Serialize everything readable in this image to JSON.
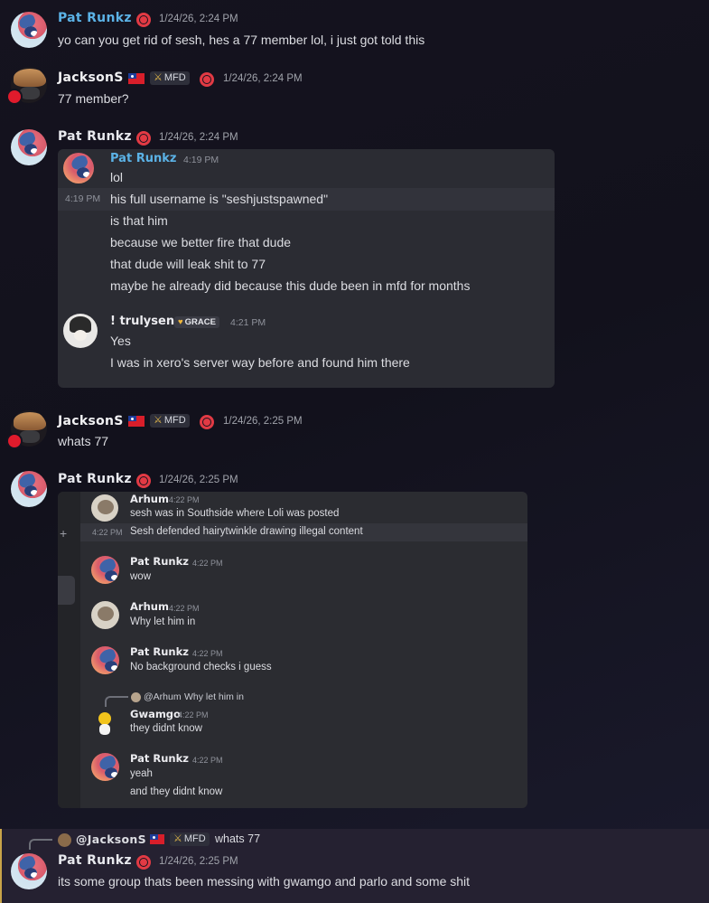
{
  "users": {
    "pat": "Pat Runkz",
    "jackson": "JacksonS",
    "senz": "! trulysenz",
    "arhum": "Arhum",
    "gwamgo": "Gwamgo"
  },
  "badges": {
    "mfd": "MFD",
    "grace": "GRACE"
  },
  "messages": [
    {
      "author": "Pat Runkz",
      "time": "1/24/26, 2:24 PM",
      "text": "yo can you get rid of sesh, hes a 77 member lol, i just got told this"
    },
    {
      "author": "JacksonS",
      "time": "1/24/26, 2:24 PM",
      "text": "77 member?"
    },
    {
      "author": "Pat Runkz",
      "time": "1/24/26, 2:24 PM"
    },
    {
      "author": "JacksonS",
      "time": "1/24/26, 2:25 PM",
      "text": "whats 77"
    },
    {
      "author": "Pat Runkz",
      "time": "1/24/26, 2:25 PM"
    },
    {
      "author": "Pat Runkz",
      "time": "1/24/26, 2:25 PM",
      "text": "its some group thats been messing with gwamgo and parlo and some shit"
    }
  ],
  "embed1": {
    "first_author": "Pat Runkz",
    "first_time": "4:19 PM",
    "hover_time": "4:19 PM",
    "lines": [
      "lol",
      "his full username is \"seshjustspawned\"",
      "is that him",
      "because we better fire that dude",
      "that dude will leak shit to 77",
      "maybe he already did because this dude been in mfd for months"
    ],
    "second_author": "! trulysenz",
    "second_badge": "GRACE",
    "second_time": "4:21 PM",
    "second_lines": [
      "Yes",
      "I was in xero's server way before and found him there"
    ]
  },
  "embed2": {
    "hover_time": "4:22 PM",
    "plus": "+",
    "items": [
      {
        "author": "Arhum",
        "time": "4:22 PM",
        "lines": [
          "sesh was in Southside where Loli was posted",
          "Sesh defended hairytwinkle drawing illegal content"
        ]
      },
      {
        "author": "Pat Runkz",
        "time": "4:22 PM",
        "lines": [
          "wow"
        ]
      },
      {
        "author": "Arhum",
        "time": "4:22 PM",
        "lines": [
          "Why let him in"
        ]
      },
      {
        "author": "Pat Runkz",
        "time": "4:22 PM",
        "lines": [
          "No background checks i guess"
        ]
      },
      {
        "author": "Gwamgo",
        "time": "4:22 PM",
        "reply_to": "@Arhum",
        "reply_text": "Why let him in",
        "lines": [
          "they didnt know"
        ]
      },
      {
        "author": "Pat Runkz",
        "time": "4:22 PM",
        "lines": [
          "yeah",
          "and they didnt know"
        ]
      }
    ]
  },
  "reply": {
    "to": "@JacksonS",
    "badge": "MFD",
    "text": "whats 77"
  },
  "colors": {
    "background": "#15131f",
    "panel": "#2b2c33",
    "globe": "#e23a44",
    "pat_name_blue": "#5bb2e6"
  }
}
